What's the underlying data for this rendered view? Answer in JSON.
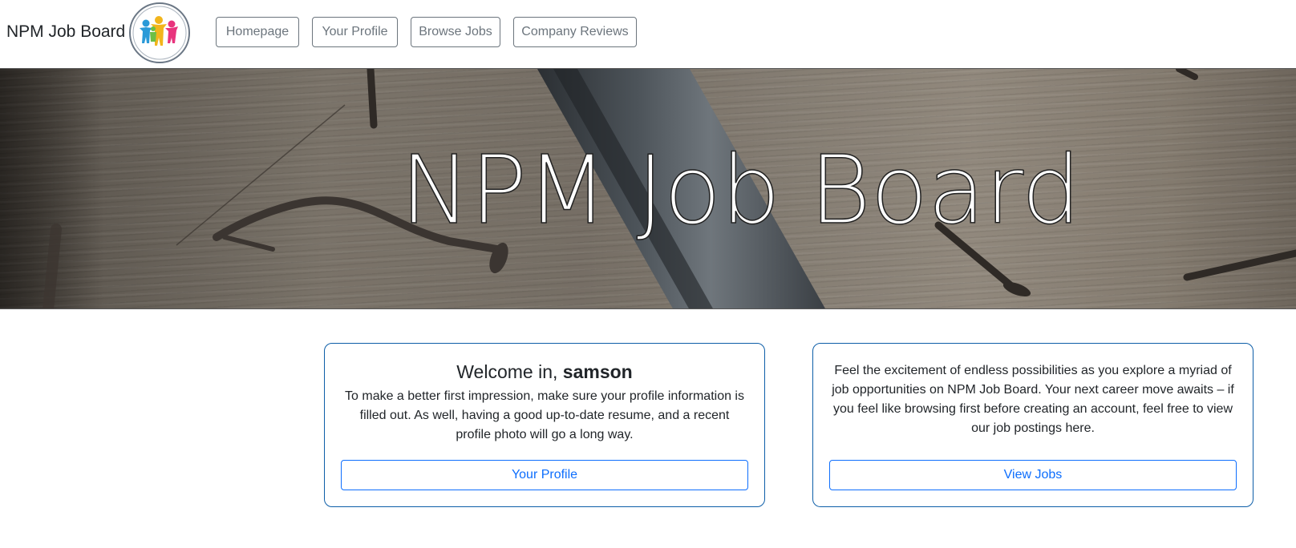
{
  "navbar": {
    "brand": "NPM Job Board",
    "logo_icon": "people-group-logo-icon",
    "links": [
      {
        "label": "Homepage"
      },
      {
        "label": "Your Profile"
      },
      {
        "label": "Browse Jobs"
      },
      {
        "label": "Company Reviews"
      }
    ]
  },
  "hero": {
    "title": "NPM Job Board"
  },
  "welcome_card": {
    "greeting": "Welcome in, ",
    "username": "samson",
    "text": "To make a better first impression, make sure your profile information is filled out. As well, having a good up-to-date resume, and a recent profile photo will go a long way.",
    "button": "Your Profile"
  },
  "jobs_card": {
    "text": "Feel the excitement of endless possibilities as you explore a myriad of job opportunities on NPM Job Board. Your next career move awaits – if you feel like browsing first before creating an account, feel free to view our job postings here.",
    "button": "View Jobs"
  },
  "colors": {
    "primary": "#0d6efd",
    "card_border": "#0d5ea8",
    "nav_border": "#6c757d"
  }
}
